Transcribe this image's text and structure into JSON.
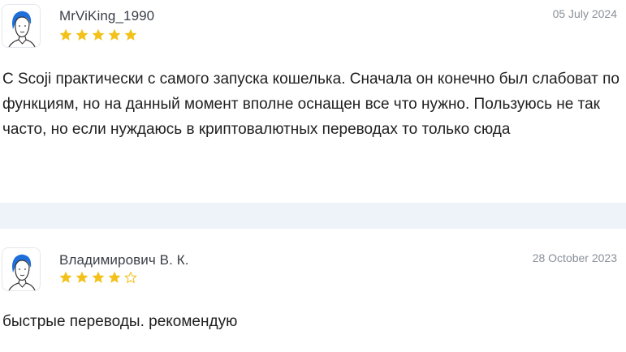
{
  "reviews": [
    {
      "author": "MrViKing_1990",
      "date": "05 July 2024",
      "rating": 5,
      "max_rating": 5,
      "text": "С Scoji практически с самого запуска кошелька. Сначала он конечно был слабоват по функциям, но на данный момент вполне оснащен все что нужно. Пользуюсь не так часто, но если нуждаюсь в криптовалютных переводах то только сюда"
    },
    {
      "author": "Владимирович В. К.",
      "date": "28 October 2023",
      "rating": 4,
      "max_rating": 5,
      "text": "быстрые переводы. рекомендую"
    }
  ],
  "colors": {
    "star_filled": "#f2c21a",
    "star_empty_stroke": "#f2c21a",
    "divider_band": "#eef3fa",
    "avatar_hair": "#1e6fd9"
  },
  "icons": {
    "avatar": "user-avatar-icon",
    "star_filled": "star-filled-icon",
    "star_empty": "star-outline-icon"
  }
}
